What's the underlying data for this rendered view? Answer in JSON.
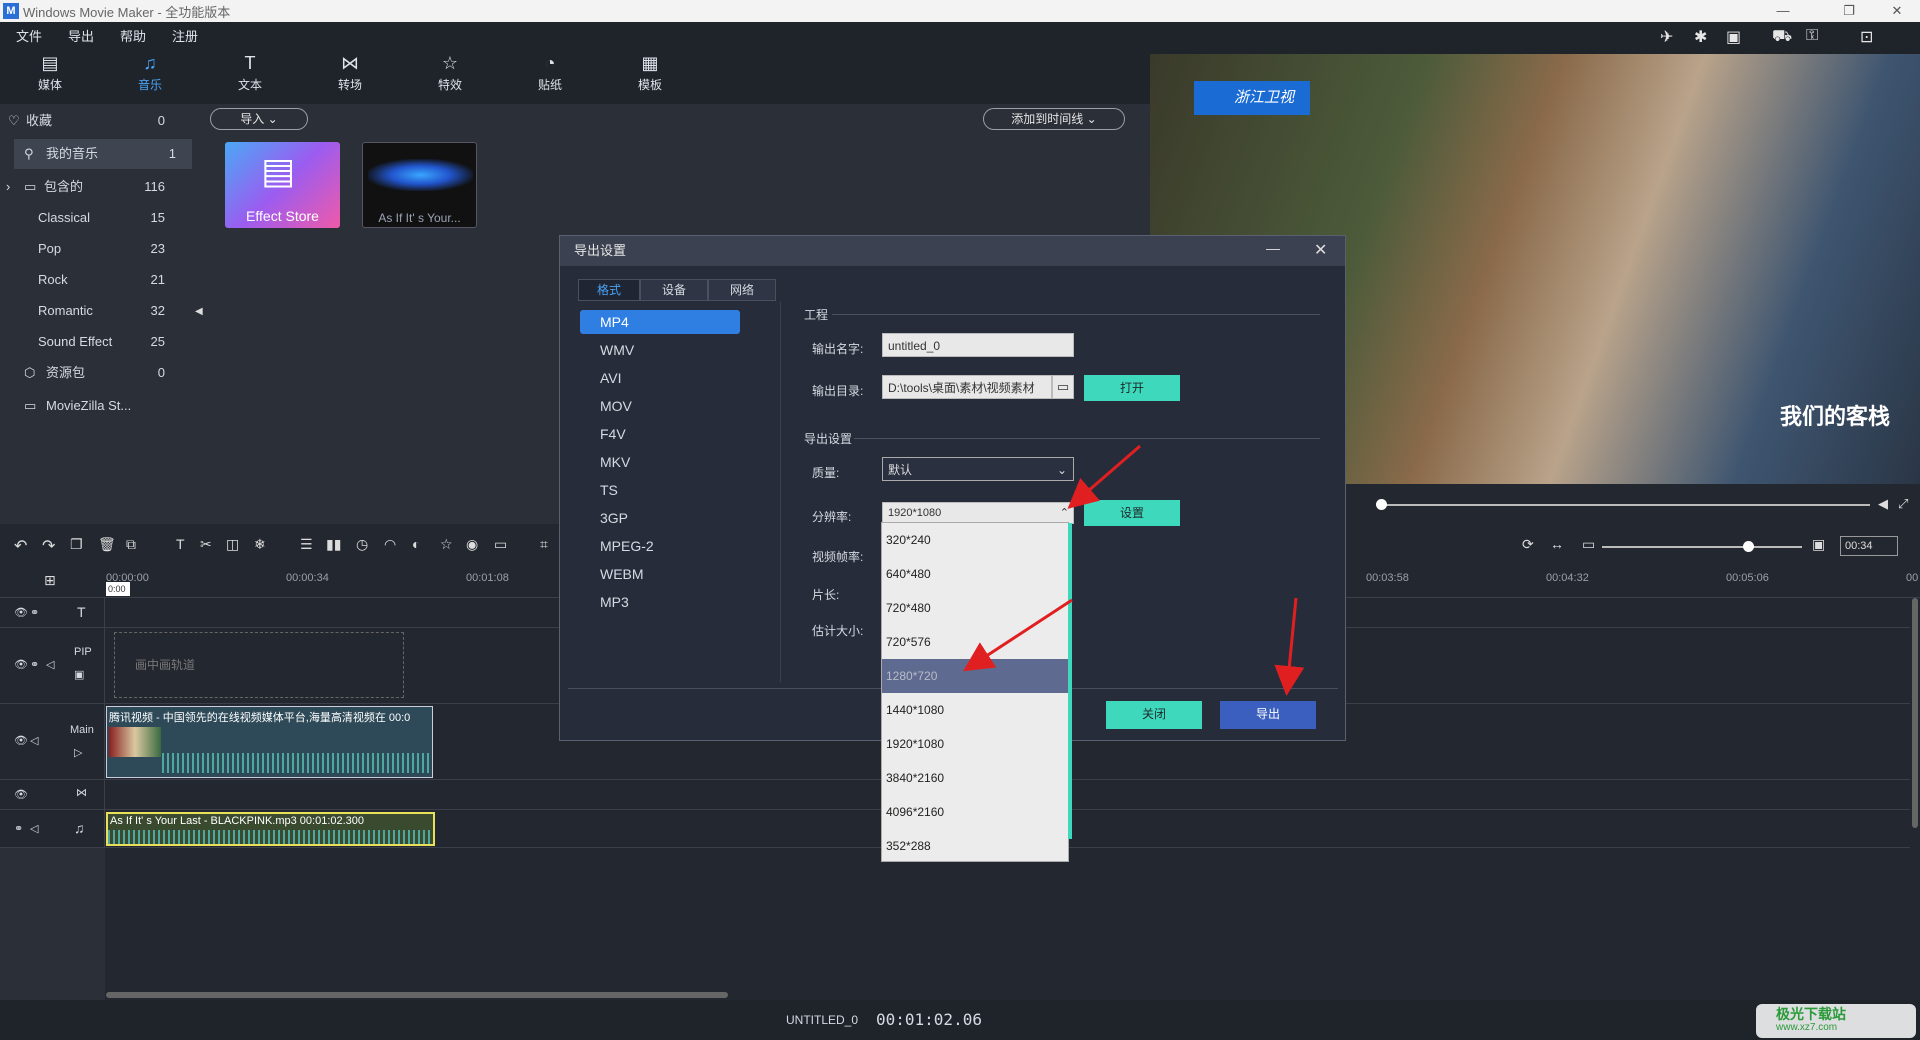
{
  "app": {
    "title": "Windows Movie Maker - 全功能版本"
  },
  "menu": [
    "文件",
    "导出",
    "帮助",
    "注册"
  ],
  "toolbar": [
    {
      "label": "媒体",
      "icon": "media-icon"
    },
    {
      "label": "音乐",
      "icon": "music-icon"
    },
    {
      "label": "文本",
      "icon": "text-icon"
    },
    {
      "label": "转场",
      "icon": "transition-icon"
    },
    {
      "label": "特效",
      "icon": "effects-icon"
    },
    {
      "label": "贴纸",
      "icon": "sticker-icon"
    },
    {
      "label": "模板",
      "icon": "template-icon"
    }
  ],
  "library": [
    {
      "label": "收藏",
      "count": "0"
    },
    {
      "label": "我的音乐",
      "count": "1"
    },
    {
      "label": "包含的",
      "count": "116"
    },
    {
      "label": "Classical",
      "count": "15"
    },
    {
      "label": "Pop",
      "count": "23"
    },
    {
      "label": "Rock",
      "count": "21"
    },
    {
      "label": "Romantic",
      "count": "32"
    },
    {
      "label": "Sound Effect",
      "count": "25"
    },
    {
      "label": "资源包",
      "count": "0"
    },
    {
      "label": "MovieZilla St...",
      "count": ""
    }
  ],
  "content": {
    "import_label": "导入",
    "add_timeline_label": "添加到时间线",
    "thumbs": [
      {
        "label": "Effect Store"
      },
      {
        "label": "As If It'  s Your..."
      }
    ]
  },
  "preview": {
    "channel_logo": "浙江卫视",
    "show_logo": "我们的客栈",
    "time": "00:34"
  },
  "timeline": {
    "ruler": [
      "00:00:00",
      "00:00:34",
      "00:01:08",
      "00:03:58",
      "00:04:32",
      "00:05:06",
      "00"
    ],
    "pip_label": "PIP",
    "pip_placeholder": "画中画轨道",
    "main_label": "Main",
    "video_clip": "腾讯视频 - 中国领先的在线视频媒体平台,海量高清视频在  00:0",
    "audio_clip": "As If It'  s Your Last - BLACKPINK.mp3   00:01:02.300",
    "playhead": "0:00"
  },
  "status": {
    "project": "UNTITLED_0",
    "timecode": "00:01:02.06",
    "watermark": "极光下载站",
    "watermark_sub": "www.xz7.com"
  },
  "dialog": {
    "title": "导出设置",
    "tabs": [
      "格式",
      "设备",
      "网络"
    ],
    "formats": [
      "MP4",
      "WMV",
      "AVI",
      "MOV",
      "F4V",
      "MKV",
      "TS",
      "3GP",
      "MPEG-2",
      "WEBM",
      "MP3"
    ],
    "section_project": "工程",
    "name_label": "输出名字:",
    "name_value": "untitled_0",
    "dir_label": "输出目录:",
    "dir_value": "D:\\tools\\桌面\\素材\\视频素材",
    "open_label": "打开",
    "section_export": "导出设置",
    "quality_label": "质量:",
    "quality_value": "默认",
    "res_label": "分辨率:",
    "res_value": "1920*1080",
    "setting_label": "设置",
    "fps_label": "视频帧率:",
    "duration_label": "片长:",
    "size_label": "估计大小:",
    "close_label": "关闭",
    "export_label": "导出"
  },
  "resolution_options": [
    "320*240",
    "640*480",
    "720*480",
    "720*576",
    "1280*720",
    "1440*1080",
    "1920*1080",
    "3840*2160",
    "4096*2160",
    "352*288"
  ]
}
